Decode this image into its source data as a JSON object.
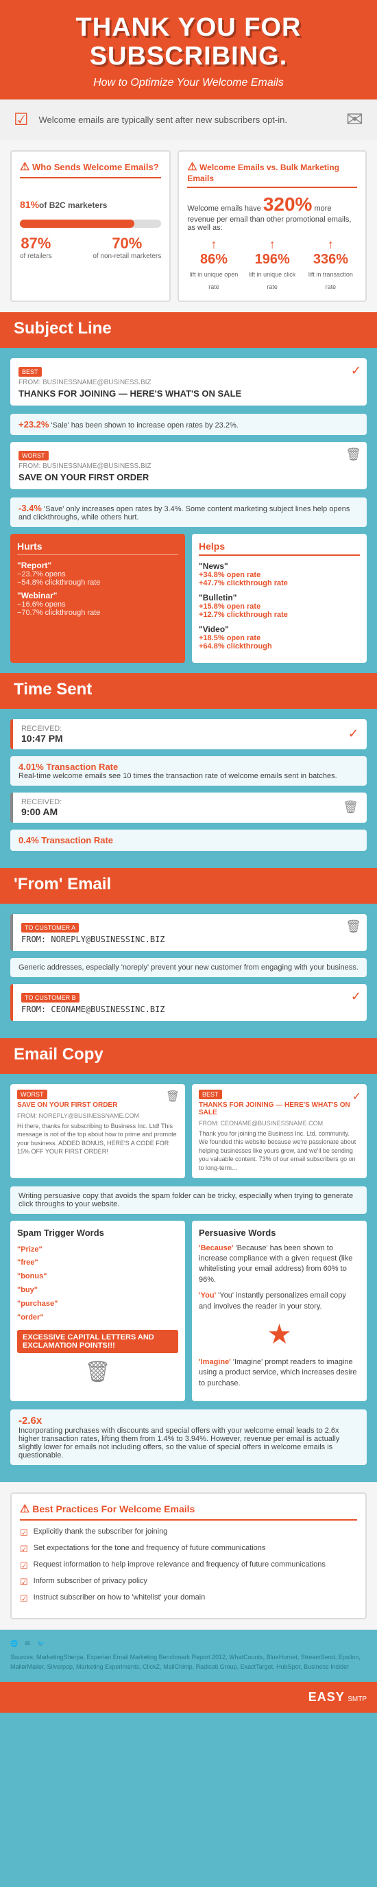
{
  "header": {
    "title_line1": "THANK YOU FOR",
    "title_line2": "SUBSCRIBING.",
    "subtitle": "How to Optimize Your Welcome Emails"
  },
  "welcome_bar": {
    "text": "Welcome emails are typically sent after new subscribers opt-in."
  },
  "who_sends": {
    "title": "Who Sends Welcome Emails?",
    "pct_b2c": "81%",
    "b2c_label": "of B2C marketers",
    "pct_retailers": "87%",
    "retailers_label": "of retailers",
    "pct_nonretail": "70%",
    "nonretail_label": "of non-retail marketers"
  },
  "vs_bulk": {
    "title": "Welcome Emails vs. Bulk Marketing Emails",
    "highlight": "320%",
    "highlight_text": "more revenue per email than other promotional emails, as well as:",
    "open_rate_pct": "86%",
    "open_rate_label": "lift in unique open rate",
    "click_rate_pct": "196%",
    "click_rate_label": "lift in unique click rate",
    "transaction_pct": "336%",
    "transaction_label": "lift in transaction rate"
  },
  "subject_line": {
    "section_title": "Subject Line",
    "good_subject": "THANKS FOR JOINING — HERE'S WHAT'S ON SALE",
    "good_from": "FROM: BUSINESSNAME@BUSINESS.BIZ",
    "good_stat": "+23.2%",
    "good_stat_text": "'Sale' has been shown to increase open rates by 23.2%.",
    "bad_subject": "SAVE ON YOUR FIRST ORDER",
    "bad_from": "FROM: BUSINESSNAME@BUSINESS.BIZ",
    "bad_stat": "-3.4%",
    "bad_stat_text": "'Save' only increases open rates by 3.4%. Some content marketing subject lines help opens and clickthroughs, while others hurt.",
    "hurts_title": "Hurts",
    "hurts_items": [
      {
        "word": "\"Report\"",
        "stat1": "-23.7% opens",
        "stat2": "-54.8% clickthrough rate"
      },
      {
        "word": "\"Webinar\"",
        "stat1": "-16.6% opens",
        "stat2": "-70.7% clickthrough rate"
      }
    ],
    "helps_title": "Helps",
    "helps_items": [
      {
        "word": "\"News\"",
        "stat1": "+34.8% open rate",
        "stat2": "+47.7% clickthrough rate"
      },
      {
        "word": "\"Bulletin\"",
        "stat1": "+15.8% open rate",
        "stat2": "+12.7% clickthrough rate"
      },
      {
        "word": "\"Video\"",
        "stat1": "+18.5% open rate",
        "stat2": "+64.8% clickthrough"
      }
    ]
  },
  "time_sent": {
    "section_title": "Time Sent",
    "good_time": "10:47 PM",
    "good_stat": "4.01% Transaction Rate",
    "good_text": "Real-time welcome emails see 10 times the transaction rate of welcome emails sent in batches.",
    "bad_time": "9:00 AM",
    "bad_stat": "0.4% Transaction Rate"
  },
  "from_email": {
    "section_title": "'From' Email",
    "bad_to": "TO: CUSTOMER A",
    "bad_from": "FROM: NOREPLY@BUSINESSINC.BIZ",
    "bad_text": "Generic addresses, especially 'noreply' prevent your new customer from engaging with your business.",
    "good_to": "TO: CUSTOMER B",
    "good_from": "FROM: CEONAME@BUSINESSINC.BIZ"
  },
  "email_copy": {
    "section_title": "Email Copy",
    "bad_subject": "SAVE ON YOUR FIRST ORDER",
    "bad_from": "FROM: NOREPLY@BUSINESSNAME.COM",
    "bad_body": "Hi there, thanks for subscribing to Business Inc. Ltd! This message is not of the top about how to prime and promote your business. ADDED BONUS, HERE'S A CODE FOR 15% OFF YOUR FIRST ORDER!",
    "good_subject": "THANKS FOR JOINING — HERE'S WHAT'S ON SALE",
    "good_from": "FROM: CEONAME@BUSINESSNAME.COM",
    "good_body": "Thank you for joining the Business Inc. Ltd. community. We founded this website because we're passionate about helping businesses like yours grow, and we'll be sending you valuable content. 73% of our email subscribers go on to long-term...",
    "copy_tip": "Writing persuasive copy that avoids the spam folder can be tricky, especially when trying to generate click throughs to your website.",
    "spam_title": "Spam Trigger Words",
    "spam_words": [
      "\"Prize\"",
      "\"free\"",
      "\"bonus\"",
      "\"buy\"",
      "\"purchase\"",
      "\"order\""
    ],
    "caps_warning": "EXCESSIVE CAPITAL LETTERS AND EXCLAMATION POINTS!!!",
    "persuasive_title": "Persuasive Words",
    "persuasive_because": "'Because' has been shown to increase compliance with a given request (like whitelisting your email address) from 60% to 96%.",
    "persuasive_you": "'You' instantly personalizes email copy and involves the reader in your story.",
    "persuasive_imagine": "'Imagine' prompt readers to imagine using a product service, which increases desire to purchase.",
    "purchases_stat": "-2.6x",
    "purchases_text": "Incorporating purchases with discounts and special offers with your welcome email leads to 2.6x higher transaction rates, lifting them from 1.4% to 3.94%. However, revenue per email is actually slightly lower for emails not including offers, so the value of special offers in welcome emails is questionable."
  },
  "best_practices": {
    "section_title": "Best Practices For Welcome Emails",
    "items": [
      "Explicitly thank the subscriber for joining",
      "Set expectations for the tone and frequency of future communications",
      "Request information to help improve relevance and frequency of future communications",
      "Inform subscriber of privacy policy",
      "Instruct subscriber on how to 'whitelist' your domain"
    ]
  },
  "footer": {
    "text": "Sources: MarketingSherpa, Experian Email Marketing Benchmark Report 2012, WhatCounts, BlueHornet, StreamSend, Epsilon, MailerMailer, Silverpop, Marketing Experiments, ClickZ, MailChimp, Radicati Group, ExactTarget, HubSpot, Business Insider",
    "brand": "EASY",
    "brand_sub": "SMTP"
  }
}
